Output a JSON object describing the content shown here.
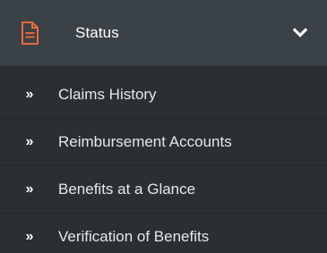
{
  "menu": {
    "header": {
      "label": "Status",
      "icon": "document-icon",
      "icon_color": "#e8693a",
      "chevron": "chevron-down-icon"
    },
    "items": [
      {
        "label": "Claims History",
        "icon": "double-chevron-right-icon"
      },
      {
        "label": "Reimbursement Accounts",
        "icon": "double-chevron-right-icon"
      },
      {
        "label": "Benefits at a Glance",
        "icon": "double-chevron-right-icon"
      },
      {
        "label": "Verification of Benefits",
        "icon": "double-chevron-right-icon"
      }
    ]
  },
  "colors": {
    "header_bg": "#3a4147",
    "menu_bg": "#2a2f33",
    "text": "#ffffff",
    "accent": "#e8693a"
  }
}
